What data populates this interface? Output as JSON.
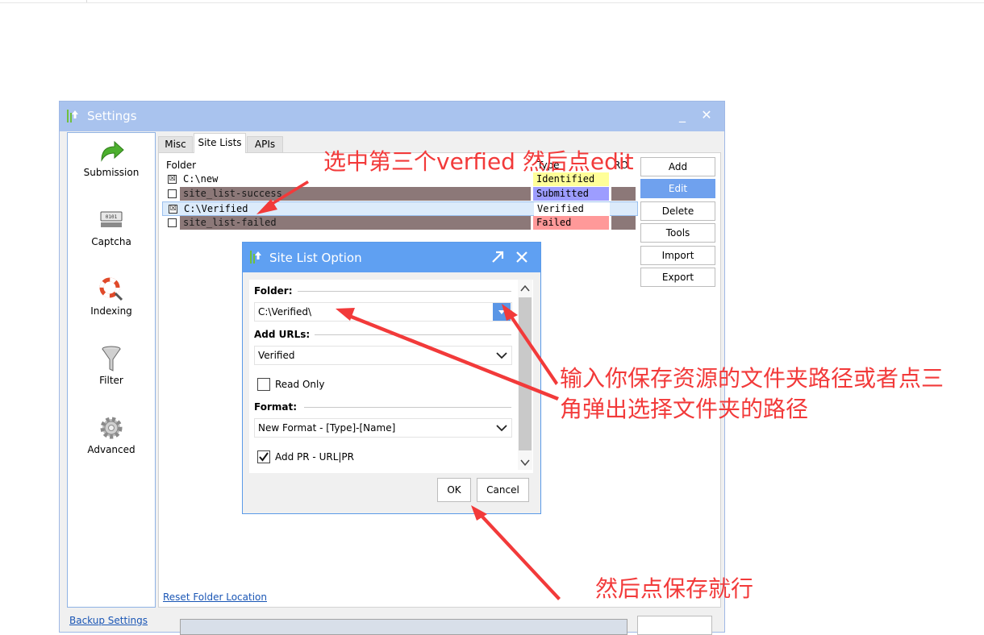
{
  "window": {
    "title": "Settings",
    "min_glyph": "_",
    "close_glyph": "✕"
  },
  "nav": [
    {
      "label": "Submission",
      "icon": "submission-arrow-icon"
    },
    {
      "label": "Captcha",
      "icon": "captcha-icon"
    },
    {
      "label": "Indexing",
      "icon": "indexing-lifebuoy-icon"
    },
    {
      "label": "Filter",
      "icon": "funnel-icon"
    },
    {
      "label": "Advanced",
      "icon": "gear-icon"
    }
  ],
  "backup_link": "Backup Settings",
  "tabs": [
    "Misc",
    "Site Lists",
    "APIs"
  ],
  "grid": {
    "headers": {
      "folder": "Folder",
      "type": "Type",
      "ro": "RO"
    },
    "rows": [
      {
        "checked": "☒",
        "folder": "C:\\new",
        "type": "Identified",
        "type_color": "#ffff99",
        "highlight": false,
        "dark": false
      },
      {
        "checked": "",
        "folder": "site_list-success",
        "type": "Submitted",
        "type_color": "#9d9dff",
        "highlight": false,
        "dark": true
      },
      {
        "checked": "☒",
        "folder": "C:\\Verified",
        "type": "Verified",
        "type_color": "#ffffff",
        "highlight": true,
        "dark": false
      },
      {
        "checked": "",
        "folder": "site_list-failed",
        "type": "Failed",
        "type_color": "#ff9999",
        "highlight": false,
        "dark": true
      }
    ]
  },
  "side_buttons": [
    "Add",
    "Edit",
    "Delete",
    "Tools",
    "Import",
    "Export"
  ],
  "reset_link": "Reset Folder Location",
  "dialog": {
    "title": "Site List Option",
    "folder_label": "Folder:",
    "folder_value": "C:\\Verified\\",
    "urls_label": "Add URLs:",
    "urls_value": "Verified",
    "read_only_label": "Read Only",
    "format_label": "Format:",
    "format_value": "New Format - [Type]-[Name]",
    "add_pr_label": "Add PR - URL|PR",
    "ok_label": "OK",
    "cancel_label": "Cancel"
  },
  "annotations": {
    "top": "选中第三个verfied 然后点edit",
    "right_line1": "输入你保存资源的文件夹路径或者点三",
    "right_line2": "角弹出选择文件夹的路径",
    "bottom": "然后点保存就行"
  },
  "colors": {
    "accent": "#5fa0f2",
    "annotation": "#f23a3a",
    "link": "#1a56b5",
    "dark_row": "#8c7878"
  }
}
